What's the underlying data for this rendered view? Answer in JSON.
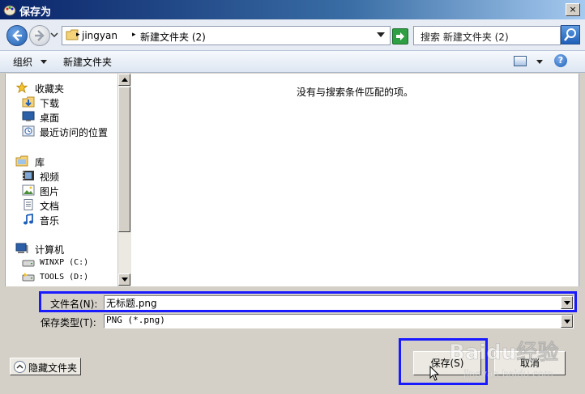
{
  "window": {
    "title": "保存为",
    "close_glyph": "×"
  },
  "address_bar": {
    "crumbs": [
      "jingyan",
      "新建文件夹 (2)"
    ],
    "separator": "▸"
  },
  "search": {
    "text": "搜索 新建文件夹 (2)"
  },
  "toolbar": {
    "organize_label": "组织",
    "new_folder_label": "新建文件夹",
    "help_glyph": "?"
  },
  "navigation": {
    "favorites": {
      "label": "收藏夹",
      "items": [
        {
          "label": "下载",
          "icon": "download-folder-icon"
        },
        {
          "label": "桌面",
          "icon": "desktop-icon"
        },
        {
          "label": "最近访问的位置",
          "icon": "recent-places-icon"
        }
      ]
    },
    "libraries": {
      "label": "库",
      "items": [
        {
          "label": "视频",
          "icon": "video-library-icon"
        },
        {
          "label": "图片",
          "icon": "pictures-library-icon"
        },
        {
          "label": "文档",
          "icon": "documents-library-icon"
        },
        {
          "label": "音乐",
          "icon": "music-library-icon"
        }
      ]
    },
    "computer": {
      "label": "计算机",
      "items": [
        {
          "label": "WINXP (C:)",
          "icon": "drive-icon"
        },
        {
          "label": "TOOLS (D:)",
          "icon": "drive-icon"
        }
      ]
    }
  },
  "content": {
    "empty_message": "没有与搜索条件匹配的项。"
  },
  "form": {
    "filename_label": "文件名(N):",
    "filename_value": "无标题.png",
    "filetype_label": "保存类型(T):",
    "filetype_value": "PNG (*.png)"
  },
  "buttons": {
    "hide_folders": "隐藏文件夹",
    "save": "保存(S)",
    "cancel": "取消"
  },
  "watermark": {
    "text": "Baidu经验",
    "sub": "jingyan.baidu.com"
  },
  "colors": {
    "highlight": "#1a1aff",
    "title_bar": "#0a246a"
  }
}
